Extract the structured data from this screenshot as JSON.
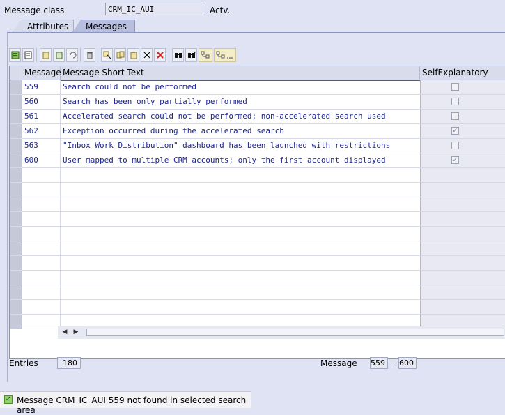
{
  "header": {
    "label": "Message class",
    "value": "CRM_IC_AUI",
    "status": "Actv."
  },
  "tabs": [
    {
      "label": "Attributes"
    },
    {
      "label": "Messages"
    }
  ],
  "toolbar": {
    "icons": [
      "details-icon",
      "display-icon",
      "copy-icon",
      "paste-icon",
      "undo-icon",
      "delete-icon",
      "select-icon",
      "copy-rows-icon",
      "insert-icon",
      "cut-icon",
      "delete-row-icon",
      "find-icon",
      "find-next-icon",
      "expand-icon",
      "collapse-icon"
    ]
  },
  "table": {
    "columns": [
      "Message",
      "Message Short Text",
      "SelfExplanatory"
    ],
    "rows": [
      {
        "num": "559",
        "text": "Search could not be performed",
        "self": false
      },
      {
        "num": "560",
        "text": "Search has been only partially performed",
        "self": false
      },
      {
        "num": "561",
        "text": "Accelerated search could not be performed; non-accelerated search used",
        "self": false
      },
      {
        "num": "562",
        "text": "Exception occurred during the accelerated search",
        "self": true
      },
      {
        "num": "563",
        "text": "\"Inbox Work Distribution\" dashboard has been launched with restrictions",
        "self": false
      },
      {
        "num": "600",
        "text": "User mapped to multiple CRM accounts; only the first account displayed",
        "self": true
      }
    ]
  },
  "footer": {
    "entries_label": "Entries",
    "entries_value": "180",
    "message_label": "Message",
    "message_from": "559",
    "message_sep": "–",
    "message_to": "600"
  },
  "status": {
    "text": "Message CRM_IC_AUI 559 not found in selected search area"
  }
}
